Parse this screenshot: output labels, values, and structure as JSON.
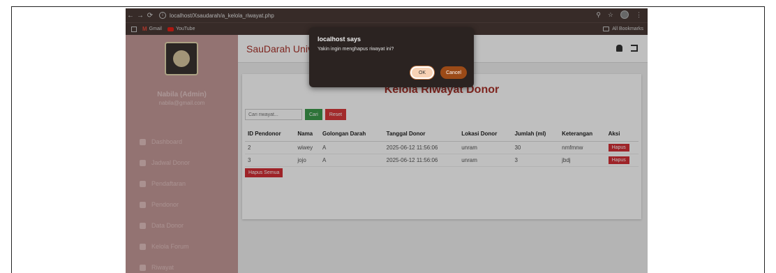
{
  "browser": {
    "url": "localhost/Xsaudarah/a_kelola_riwayat.php",
    "bookmarks": [
      {
        "label": "Gmail"
      },
      {
        "label": "YouTube"
      }
    ],
    "all_bookmarks": "All Bookmarks"
  },
  "sidebar": {
    "admin_name": "Nabila (Admin)",
    "admin_email": "nabila@gmail.com",
    "items": [
      {
        "label": "Dashboard",
        "icon": "home-icon"
      },
      {
        "label": "Jadwal Donor",
        "icon": "calendar-icon"
      },
      {
        "label": "Pendaftaran",
        "icon": "clipboard-icon"
      },
      {
        "label": "Pendonor",
        "icon": "users-icon"
      },
      {
        "label": "Data Donor",
        "icon": "database-icon"
      },
      {
        "label": "Kelola Forum",
        "icon": "forum-icon"
      },
      {
        "label": "Riwayat",
        "icon": "history-icon"
      }
    ]
  },
  "header": {
    "brand": "SauDarah Univ"
  },
  "page": {
    "title": "Kelola Riwayat Donor",
    "search_placeholder": "Cari riwayat...",
    "cari_label": "Cari",
    "reset_label": "Reset",
    "hapus_semua_label": "Hapus Semua",
    "columns": [
      "ID Pendonor",
      "Nama",
      "Golongan Darah",
      "Tanggal Donor",
      "Lokasi Donor",
      "Jumlah (ml)",
      "Keterangan",
      "Aksi"
    ],
    "rows": [
      {
        "id": "2",
        "nama": "wiwey",
        "gol": "A",
        "tanggal": "2025-06-12 11:56:06",
        "lokasi": "unram",
        "jumlah": "30",
        "ket": "nmfmnw",
        "aksi": "Hapus"
      },
      {
        "id": "3",
        "nama": "jojo",
        "gol": "A",
        "tanggal": "2025-06-12 11:56:06",
        "lokasi": "unram",
        "jumlah": "3",
        "ket": "jbdj",
        "aksi": "Hapus"
      }
    ]
  },
  "dialog": {
    "title": "localhost says",
    "message": "Yakin ingin menghapus riwayat ini?",
    "ok_label": "OK",
    "cancel_label": "Cancel"
  },
  "colors": {
    "accent": "#a8322a",
    "sidebar": "#c49a99",
    "danger": "#d32f36",
    "success": "#3c9a4b"
  }
}
